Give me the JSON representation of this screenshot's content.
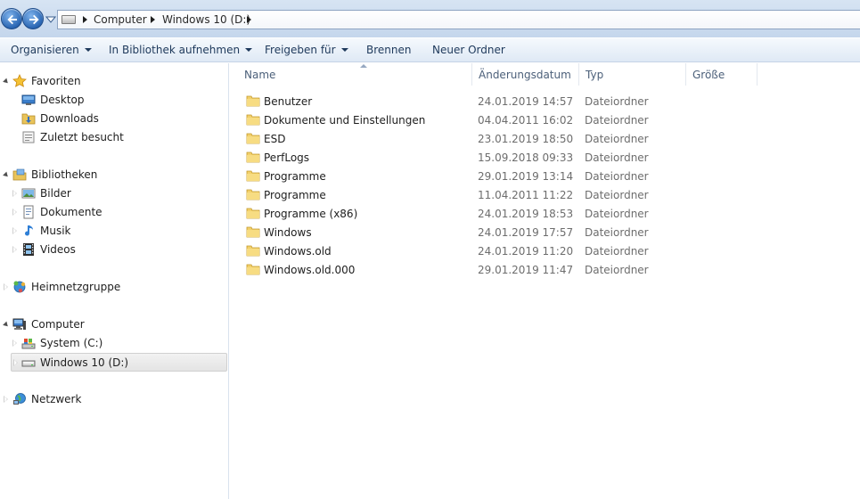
{
  "address": {
    "crumbs": [
      "Computer",
      "Windows 10 (D:)"
    ]
  },
  "toolbar": {
    "organize": "Organisieren",
    "library": "In Bibliothek aufnehmen",
    "share": "Freigeben für",
    "burn": "Brennen",
    "new_folder": "Neuer Ordner"
  },
  "nav": {
    "favorites": {
      "label": "Favoriten",
      "items": [
        "Desktop",
        "Downloads",
        "Zuletzt besucht"
      ]
    },
    "libraries": {
      "label": "Bibliotheken",
      "items": [
        "Bilder",
        "Dokumente",
        "Musik",
        "Videos"
      ]
    },
    "homegroup": {
      "label": "Heimnetzgruppe"
    },
    "computer": {
      "label": "Computer",
      "items": [
        "System (C:)",
        "Windows 10 (D:)"
      ],
      "selected": "Windows 10 (D:)"
    },
    "network": {
      "label": "Netzwerk"
    }
  },
  "columns": {
    "name": "Name",
    "date": "Änderungsdatum",
    "type": "Typ",
    "size": "Größe"
  },
  "files": [
    {
      "name": "Benutzer",
      "date": "24.01.2019 14:57",
      "type": "Dateiordner"
    },
    {
      "name": "Dokumente und Einstellungen",
      "date": "04.04.2011 16:02",
      "type": "Dateiordner"
    },
    {
      "name": "ESD",
      "date": "23.01.2019 18:50",
      "type": "Dateiordner"
    },
    {
      "name": "PerfLogs",
      "date": "15.09.2018 09:33",
      "type": "Dateiordner"
    },
    {
      "name": "Programme",
      "date": "29.01.2019 13:14",
      "type": "Dateiordner"
    },
    {
      "name": "Programme",
      "date": "11.04.2011 11:22",
      "type": "Dateiordner"
    },
    {
      "name": "Programme (x86)",
      "date": "24.01.2019 18:53",
      "type": "Dateiordner"
    },
    {
      "name": "Windows",
      "date": "24.01.2019 17:57",
      "type": "Dateiordner"
    },
    {
      "name": "Windows.old",
      "date": "24.01.2019 11:20",
      "type": "Dateiordner"
    },
    {
      "name": "Windows.old.000",
      "date": "29.01.2019 11:47",
      "type": "Dateiordner"
    }
  ],
  "icons": {
    "folder": "folder-icon",
    "star": "star-icon",
    "library": "library-icon",
    "homegroup": "homegroup-icon",
    "computer": "computer-icon",
    "network": "network-icon",
    "drive": "drive-icon"
  }
}
